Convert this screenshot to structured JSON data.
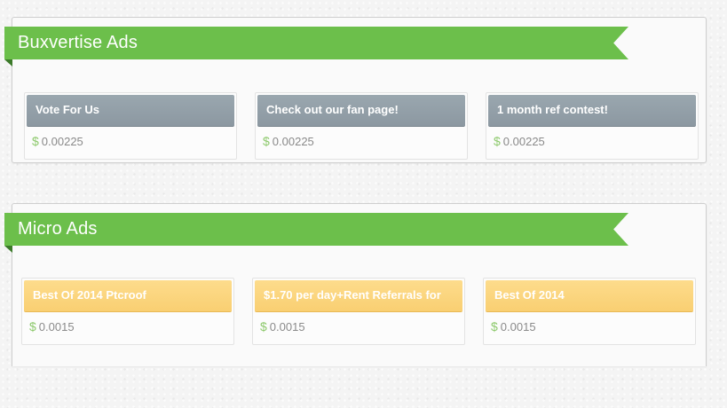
{
  "sections": [
    {
      "title": "Buxvertise Ads",
      "ads": [
        {
          "title": "Vote For Us",
          "price": "0.00225"
        },
        {
          "title": "Check out our fan page!",
          "price": "0.00225"
        },
        {
          "title": "1 month ref contest!",
          "price": "0.00225"
        }
      ]
    },
    {
      "title": "Micro Ads",
      "ads": [
        {
          "title": "Best Of 2014 Ptcroof",
          "price": "0.0015"
        },
        {
          "title": "$1.70 per day+Rent Referrals for",
          "price": "0.0015"
        },
        {
          "title": "Best Of 2014",
          "price": "0.0015"
        }
      ]
    }
  ],
  "currency_symbol": "$",
  "colors": {
    "ribbon": "#6cbf4b",
    "buxvertise_ad_header": "#909da5",
    "micro_ad_header": "#fbd47e",
    "currency": "#8dc96c"
  }
}
